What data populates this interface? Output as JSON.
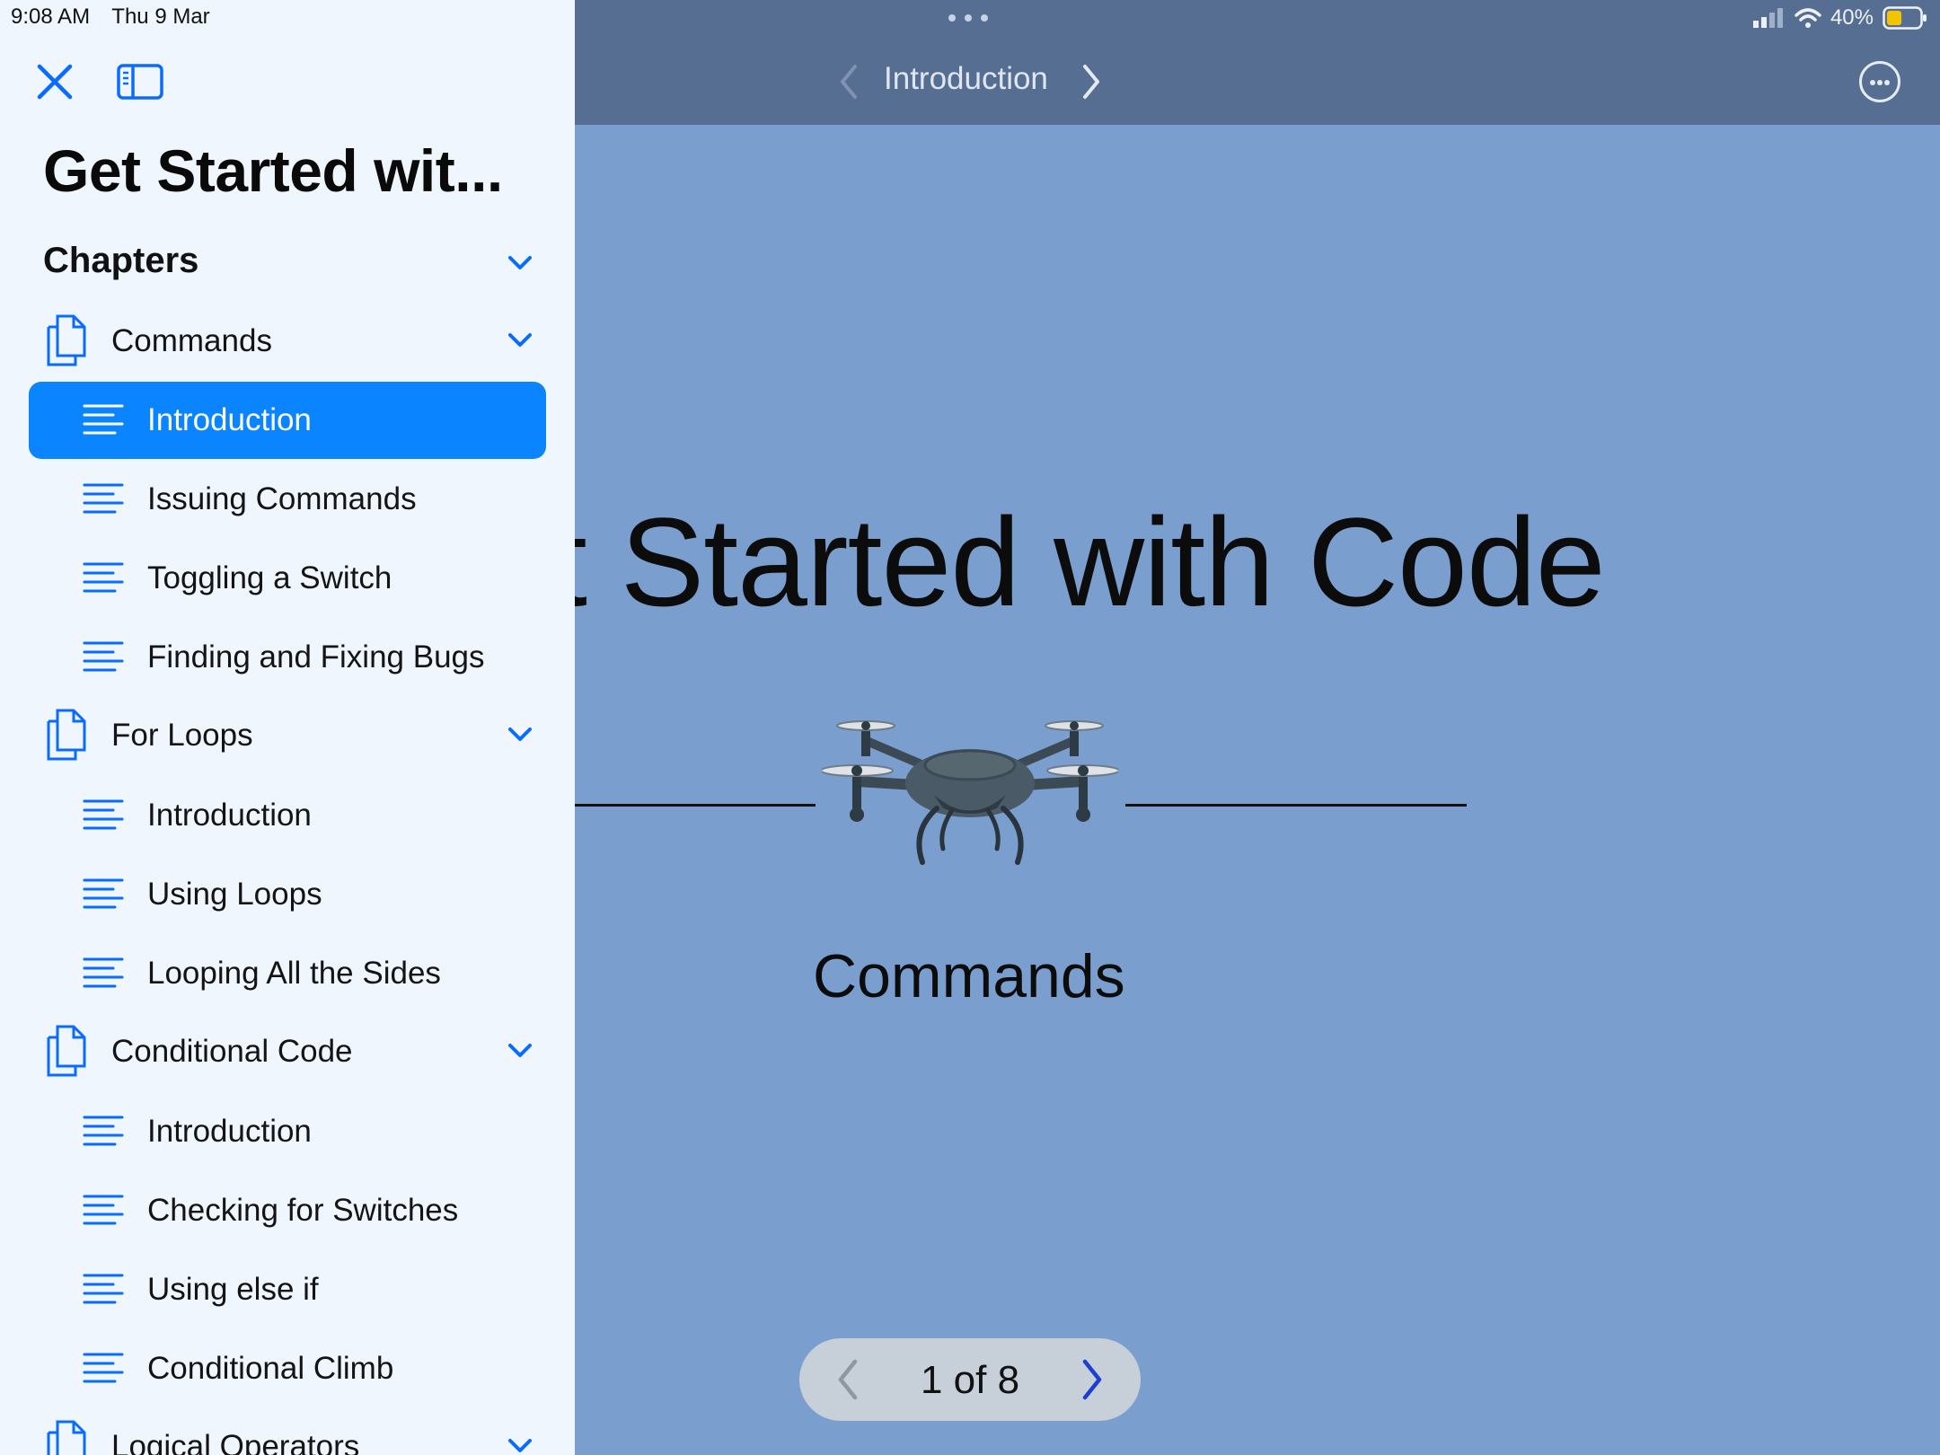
{
  "status_bar": {
    "time": "9:08 AM",
    "date": "Thu 9 Mar",
    "battery": "40%"
  },
  "sidebar": {
    "book_title": "Get Started wit...",
    "section_header": "Chapters",
    "chapters": [
      {
        "title": "Commands",
        "pages": [
          "Introduction",
          "Issuing Commands",
          "Toggling a Switch",
          "Finding and Fixing Bugs"
        ]
      },
      {
        "title": "For Loops",
        "pages": [
          "Introduction",
          "Using Loops",
          "Looping All the Sides"
        ]
      },
      {
        "title": "Conditional Code",
        "pages": [
          "Introduction",
          "Checking for Switches",
          "Using else if",
          "Conditional Climb"
        ]
      },
      {
        "title": "Logical Operators",
        "pages": []
      }
    ],
    "selected_page": "Introduction"
  },
  "nav": {
    "title": "Introduction"
  },
  "content": {
    "title": "t Started with Code",
    "subtitle": "Commands",
    "pager": "1 of 8"
  },
  "colors": {
    "accent": "#0a84ff",
    "content_bg": "#7a9ecd",
    "topbar_bg": "#566e92",
    "sidebar_bg": "#f0f6fe"
  }
}
